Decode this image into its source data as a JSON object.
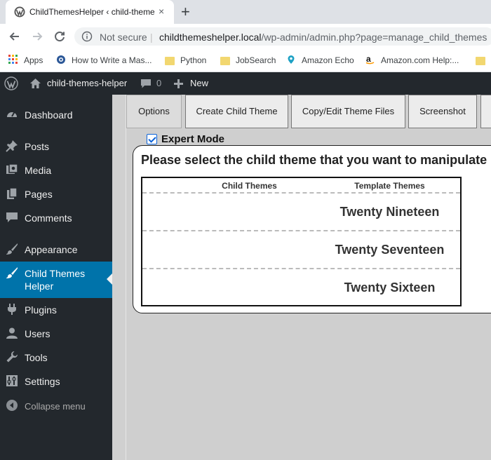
{
  "browser": {
    "tab_title": "ChildThemesHelper ‹ child-theme",
    "tab_close": "×",
    "new_tab": "+",
    "not_secure": "Not secure",
    "url_host": "childthemeshelper.local",
    "url_path": "/wp-admin/admin.php?page=manage_child_themes",
    "separator": "|"
  },
  "bookmarks": [
    {
      "label": "Apps",
      "icon": "apps-grid-icon"
    },
    {
      "label": "How to Write a Mas...",
      "icon": "globe-icon"
    },
    {
      "label": "Python",
      "icon": "folder-icon"
    },
    {
      "label": "JobSearch",
      "icon": "folder-icon"
    },
    {
      "label": "Amazon Echo",
      "icon": "location-pin-icon"
    },
    {
      "label": "Amazon.com Help:...",
      "icon": "amazon-icon"
    }
  ],
  "adminbar": {
    "site_name": "child-themes-helper",
    "comments_count": "0",
    "new_label": "New"
  },
  "sidebar": {
    "items": [
      {
        "label": "Dashboard",
        "icon": "dashboard-icon"
      },
      {
        "label": "Posts",
        "icon": "pushpin-icon"
      },
      {
        "label": "Media",
        "icon": "media-icon"
      },
      {
        "label": "Pages",
        "icon": "pages-icon"
      },
      {
        "label": "Comments",
        "icon": "comment-icon"
      },
      {
        "label": "Appearance",
        "icon": "paintbrush-icon"
      },
      {
        "label": "Child Themes",
        "label2": "Helper",
        "icon": "paintbrush-icon"
      },
      {
        "label": "Plugins",
        "icon": "plug-icon"
      },
      {
        "label": "Users",
        "icon": "user-icon"
      },
      {
        "label": "Tools",
        "icon": "wrench-icon"
      },
      {
        "label": "Settings",
        "icon": "settings-icon"
      },
      {
        "label": "Collapse menu",
        "icon": "collapse-icon"
      }
    ]
  },
  "tabs": [
    {
      "label": "Options"
    },
    {
      "label": "Create Child Theme"
    },
    {
      "label": "Copy/Edit Theme Files"
    },
    {
      "label": "Screenshot"
    }
  ],
  "expert_mode": {
    "label": "Expert Mode",
    "checked": true
  },
  "panel": {
    "title": "Please select the child theme that you want to manipulate",
    "headers": {
      "child": "Child Themes",
      "template": "Template Themes"
    },
    "rows": [
      {
        "child": "",
        "template": "Twenty Nineteen"
      },
      {
        "child": "",
        "template": "Twenty Seventeen"
      },
      {
        "child": "",
        "template": "Twenty Sixteen"
      }
    ]
  },
  "colors": {
    "wp_dark": "#23282d",
    "wp_accent": "#0073aa",
    "checkbox": "#0b62d8"
  }
}
